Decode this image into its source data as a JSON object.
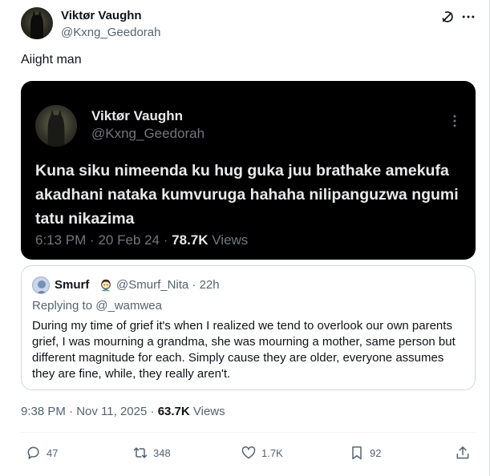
{
  "author": {
    "name": "Viktør Vaughn",
    "handle": "@Kxng_Geedorah"
  },
  "tweet": {
    "text": "Aiight man"
  },
  "embedded_screenshot": {
    "name": "Viktør Vaughn",
    "handle": "@Kxng_Geedorah",
    "body": "Kuna siku nimeenda ku hug guka juu brathake amekufa akadhani nataka kumvuruga hahaha nilipanguzwa ngumi tatu nikazima",
    "time": "6:13 PM",
    "date": "20 Feb 24",
    "views_count": "78.7K",
    "views_label": "Views",
    "sep": "·"
  },
  "quoted": {
    "name": "Smurf",
    "handle": "@Smurf_Nita",
    "time_ago": "· 22h",
    "replying_to": "Replying to @_wamwea",
    "body": "During my time of grief it's when I realized we tend to overlook our own parents grief, I was mourning a grandma, she was mourning a mother, same person but different magnitude for each. Simply cause they are older, everyone assumes they are fine, while, they really aren't."
  },
  "meta": {
    "time": "9:38 PM",
    "sep": "·",
    "date": "Nov 11, 2025",
    "views_count": "63.7K",
    "views_label": "Views"
  },
  "actions": {
    "replies": "47",
    "reposts": "348",
    "likes": "1.7K",
    "bookmarks": "92"
  },
  "icons": {
    "grok": "grok-icon",
    "more": "more-icon",
    "reply": "reply-icon",
    "repost": "repost-icon",
    "like": "heart-icon",
    "bookmark": "bookmark-icon",
    "share": "share-icon"
  },
  "colors": {
    "text": "#0f1419",
    "secondary": "#536471",
    "dark_bg": "#000000",
    "dark_text": "#e7e9ea",
    "dark_secondary": "#71767b",
    "border": "#cfd9de"
  }
}
